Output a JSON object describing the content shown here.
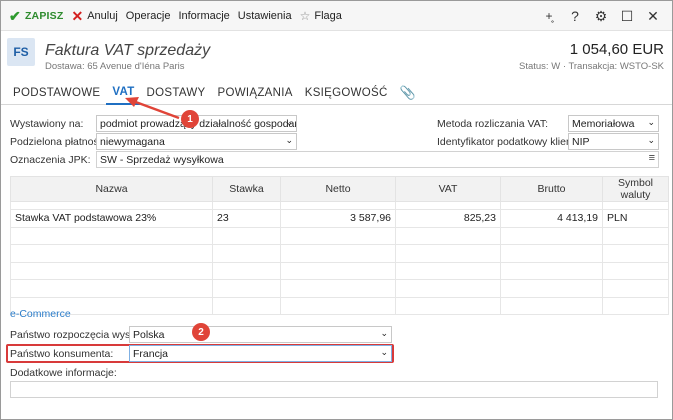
{
  "toolbar": {
    "save_label": "ZAPISZ",
    "cancel_label": "Anuluj",
    "operations_label": "Operacje",
    "info_label": "Informacje",
    "settings_label": "Ustawienia",
    "flag_label": "Flaga"
  },
  "header": {
    "badge": "FS",
    "title": "Faktura VAT sprzedaży",
    "delivery": "Dostawa: 65 Avenue d'Iéna Paris",
    "amount": "1 054,60 EUR",
    "status": "Status:  W  ·  Transakcja:  WSTO-SK"
  },
  "tabs": [
    {
      "label": "PODSTAWOWE"
    },
    {
      "label": "VAT"
    },
    {
      "label": "DOSTAWY"
    },
    {
      "label": "POWIĄZANIA"
    },
    {
      "label": "KSIĘGOWOŚĆ"
    }
  ],
  "form": {
    "issued_label": "Wystawiony na:",
    "issued_value": "podmiot prowadzący działalność gospodarczą",
    "split_label": "Podzielona płatność:",
    "split_value": "niewymagana",
    "jpk_label": "Oznaczenia JPK:",
    "jpk_value": "SW - Sprzedaż wysyłkowa",
    "vat_method_label": "Metoda rozliczania VAT:",
    "vat_method_value": "Memoriałowa",
    "tax_id_label": "Identyfikator podatkowy klienta:",
    "tax_id_value": "NIP"
  },
  "table": {
    "headers": [
      "Nazwa",
      "Stawka",
      "Netto",
      "VAT",
      "Brutto",
      "Symbol waluty"
    ],
    "rows": [
      [
        "Stawka VAT podstawowa 23%",
        "23",
        "3 587,96",
        "825,23",
        "4 413,19",
        "PLN"
      ]
    ]
  },
  "ecommerce": {
    "section_label": "e-Commerce",
    "origin_label": "Państwo rozpoczęcia wysyłki:",
    "origin_value": "Polska",
    "consumer_label": "Państwo konsumenta:",
    "consumer_value": "Francja",
    "extra_label": "Dodatkowe informacje:",
    "extra_value": ""
  },
  "annotations": {
    "badge1": "1",
    "badge2": "2",
    "color": "#e04438"
  },
  "colors": {
    "accent": "#1f6fc2",
    "save_green": "#2e8b2e",
    "cancel_red": "#d32020"
  }
}
